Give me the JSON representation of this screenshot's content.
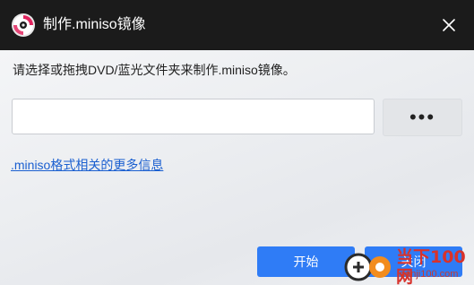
{
  "window": {
    "title": "制作.miniso镜像"
  },
  "main": {
    "instruction": "请选择或拖拽DVD/蓝光文件夹来制作.miniso镜像。",
    "path_input": {
      "value": "",
      "placeholder": ""
    },
    "browse_label": "•••",
    "info_link": ".miniso格式相关的更多信息"
  },
  "footer": {
    "start_label": "开始",
    "close_label": "关闭"
  },
  "watermark": {
    "site_name": "当下100网",
    "site_url": "danji100.com"
  },
  "icons": {
    "app": "disc-icon",
    "close": "close-icon"
  },
  "colors": {
    "titlebar_bg": "#1b1b1b",
    "accent": "#2f7cf6",
    "link": "#1a5fd0",
    "app_icon": "#e0245e"
  }
}
